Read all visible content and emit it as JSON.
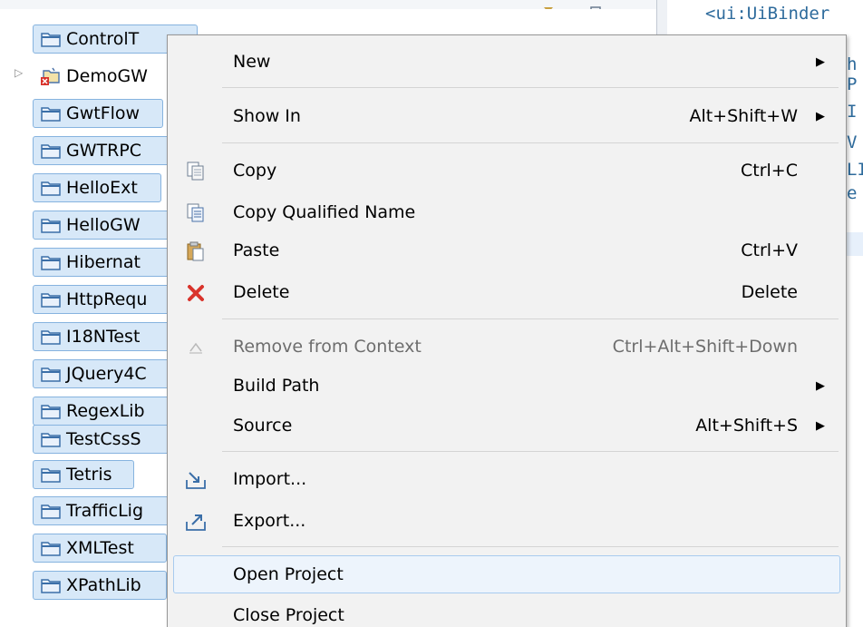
{
  "explorer": {
    "projects": [
      {
        "name": "ControlT",
        "state": "folder"
      },
      {
        "name": "DemoGW",
        "state": "java-error"
      },
      {
        "name": "GwtFlow",
        "state": "folder"
      },
      {
        "name": "GWTRPC",
        "state": "folder"
      },
      {
        "name": "HelloExt",
        "state": "folder"
      },
      {
        "name": "HelloGW",
        "state": "folder"
      },
      {
        "name": "Hibernat",
        "state": "folder"
      },
      {
        "name": "HttpRequ",
        "state": "folder"
      },
      {
        "name": "I18NTest",
        "state": "folder"
      },
      {
        "name": "JQuery4C",
        "state": "folder"
      },
      {
        "name": "RegexLib",
        "state": "folder"
      },
      {
        "name": "TestCssS",
        "state": "folder"
      },
      {
        "name": "Tetris",
        "state": "folder"
      },
      {
        "name": "TrafficLig",
        "state": "folder"
      },
      {
        "name": "XMLTest",
        "state": "folder"
      },
      {
        "name": "XPathLib",
        "state": "folder"
      }
    ],
    "expander": "▷"
  },
  "editor": {
    "lines": [
      "<ui:UiBinder",
      "  =",
      "h",
      "P",
      "I",
      "V",
      "LI",
      "e"
    ]
  },
  "context_menu": {
    "items": [
      {
        "label": "New",
        "shortcut": "",
        "submenu": true,
        "icon": ""
      },
      {
        "label": "Show In",
        "shortcut": "Alt+Shift+W",
        "submenu": true,
        "icon": ""
      },
      {
        "label": "Copy",
        "shortcut": "Ctrl+C",
        "submenu": false,
        "icon": "copy-icon"
      },
      {
        "label": "Copy Qualified Name",
        "shortcut": "",
        "submenu": false,
        "icon": "copy-qualified-name-icon"
      },
      {
        "label": "Paste",
        "shortcut": "Ctrl+V",
        "submenu": false,
        "icon": "paste-icon"
      },
      {
        "label": "Delete",
        "shortcut": "Delete",
        "submenu": false,
        "icon": "delete-icon"
      },
      {
        "label": "Remove from Context",
        "shortcut": "Ctrl+Alt+Shift+Down",
        "submenu": false,
        "icon": "remove-from-context-icon",
        "disabled": true
      },
      {
        "label": "Build Path",
        "shortcut": "",
        "submenu": true,
        "icon": ""
      },
      {
        "label": "Source",
        "shortcut": "Alt+Shift+S",
        "submenu": true,
        "icon": ""
      },
      {
        "label": "Import...",
        "shortcut": "",
        "submenu": false,
        "icon": "import-icon"
      },
      {
        "label": "Export...",
        "shortcut": "",
        "submenu": false,
        "icon": "export-icon"
      },
      {
        "label": "Open Project",
        "shortcut": "",
        "submenu": false,
        "icon": "",
        "highlighted": true
      },
      {
        "label": "Close Project",
        "shortcut": "",
        "submenu": false,
        "icon": ""
      }
    ],
    "submenu_arrow": "▶"
  },
  "colors": {
    "selection_fill": "#d7e8f8",
    "selection_border": "#86b3df",
    "menu_background": "#f2f2f2",
    "highlight_fill": "#edf4fc",
    "highlight_border": "#a8cbef",
    "code_text": "#2e6b9c",
    "delete_red": "#d9332b"
  }
}
